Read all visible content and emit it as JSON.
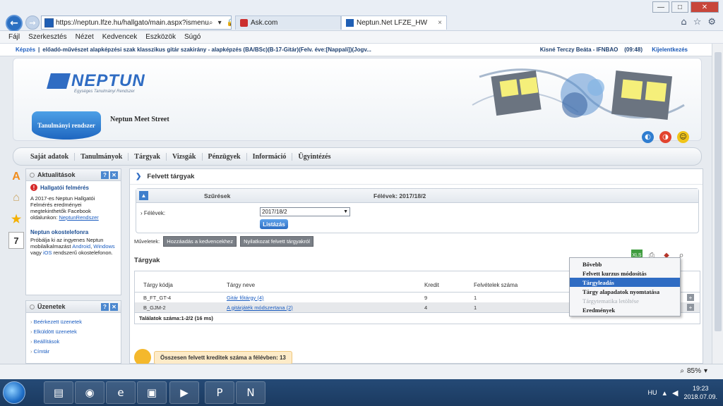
{
  "browser": {
    "url": "https://neptun.lfze.hu/hallgato/main.aspx?ismenu",
    "tabs": [
      {
        "label": "Ask.com"
      },
      {
        "label": "Neptun.Net LFZE_HW"
      }
    ],
    "tab_close": "×",
    "addr_icons": "⌕ ▾ 🔒 ↻",
    "window_controls": {
      "minimize": "—",
      "maximize": "□",
      "close": "✕"
    },
    "chrome_icons": {
      "home": "⌂",
      "favorites": "☆",
      "settings": "⚙"
    }
  },
  "menubar": [
    "Fájl",
    "Szerkesztés",
    "Nézet",
    "Kedvencek",
    "Eszközök",
    "Súgó"
  ],
  "infobar": {
    "training_label": "Képzés",
    "separator": "|",
    "training": "előadó-művészet alapképzési szak klasszikus gitár szakirány - alapképzés (BA/BSc)(B-17-Gitár)(Felv. éve:[Nappali])(Jogv...",
    "user": "Kisné Terczy Beáta - IFNBAO",
    "time": "(09:48)",
    "logout": "Kijelentkezés"
  },
  "header": {
    "logo": "NEPTUN",
    "logo_sub": "Egységes Tanulmányi Rendszer",
    "system_badge": "Tanulmányi rendszer",
    "meet_street": "Neptun Meet Street"
  },
  "mainnav": [
    "Saját adatok",
    "Tanulmányok",
    "Tárgyak",
    "Vizsgák",
    "Pénzügyek",
    "Információ",
    "Ügyintézés"
  ],
  "side_icons": {
    "a": "A",
    "calendar": "7"
  },
  "news": {
    "title": "Aktualitások",
    "item_title": "Hallgatói felmérés",
    "text": "A 2017-es Neptun Hallgatói Felmérés eredményei megtekinthetők Facebook oldalunkon:",
    "link": "NeptunRendszer",
    "mobile_title": "Neptun okostelefonra",
    "mobile_text_1": "Próbálja ki az ingyenes Neptun mobilalkalmazást",
    "mobile_android": "Android",
    "mobile_windows": "Windows",
    "mobile_or": "vagy",
    "mobile_ios": "iOS",
    "mobile_text_2": "rendszerű okostelefonon."
  },
  "messages": {
    "title": "Üzenetek",
    "items": [
      "Beérkezett üzenetek",
      "Elküldött üzenetek",
      "Beállítások",
      "Címtár"
    ]
  },
  "panel_buttons": {
    "help": "?",
    "close": "✕"
  },
  "main": {
    "section_title": "Felvett tárgyak",
    "filters_label": "Szűrések",
    "semester_summary": "Félévek: 2017/18/2",
    "semester_label": "Félévek:",
    "semester_value": "2017/18/2",
    "list_button": "Listázás",
    "operations_label": "Műveletek:",
    "op_add_favorites": "Hozzáadás a kedvencekhez",
    "op_statement": "Nyilatkozat felvett tárgyakról",
    "courses_label": "Tárgyak",
    "table": {
      "headers": [
        "Tárgy kódja",
        "Tárgy neve",
        "Kredit",
        "Felvételek száma"
      ],
      "rows": [
        {
          "code": "B_FT_GT-4",
          "name": "Gitár főtárgy (4)",
          "credit": "9",
          "count": "1"
        },
        {
          "code": "B_GJM-2",
          "name": "A gitárjáték módszertana (2)",
          "credit": "4",
          "count": "1"
        }
      ],
      "results": "Találatok száma:1-2/2 (16 ms)"
    },
    "credits_message": "Összesen felvett kreditek száma a félévben: 13"
  },
  "context_menu": [
    "Bővebb",
    "Felvett kurzus módosítás",
    "Tárgyleadás",
    "Tárgy alapadatok nyomtatása",
    "Tárgytematika letöltése",
    "Eredmények"
  ],
  "statusbar": {
    "zoom": "85%"
  },
  "taskbar": {
    "lang": "HU",
    "time": "19:23",
    "date": "2018.07.09."
  }
}
